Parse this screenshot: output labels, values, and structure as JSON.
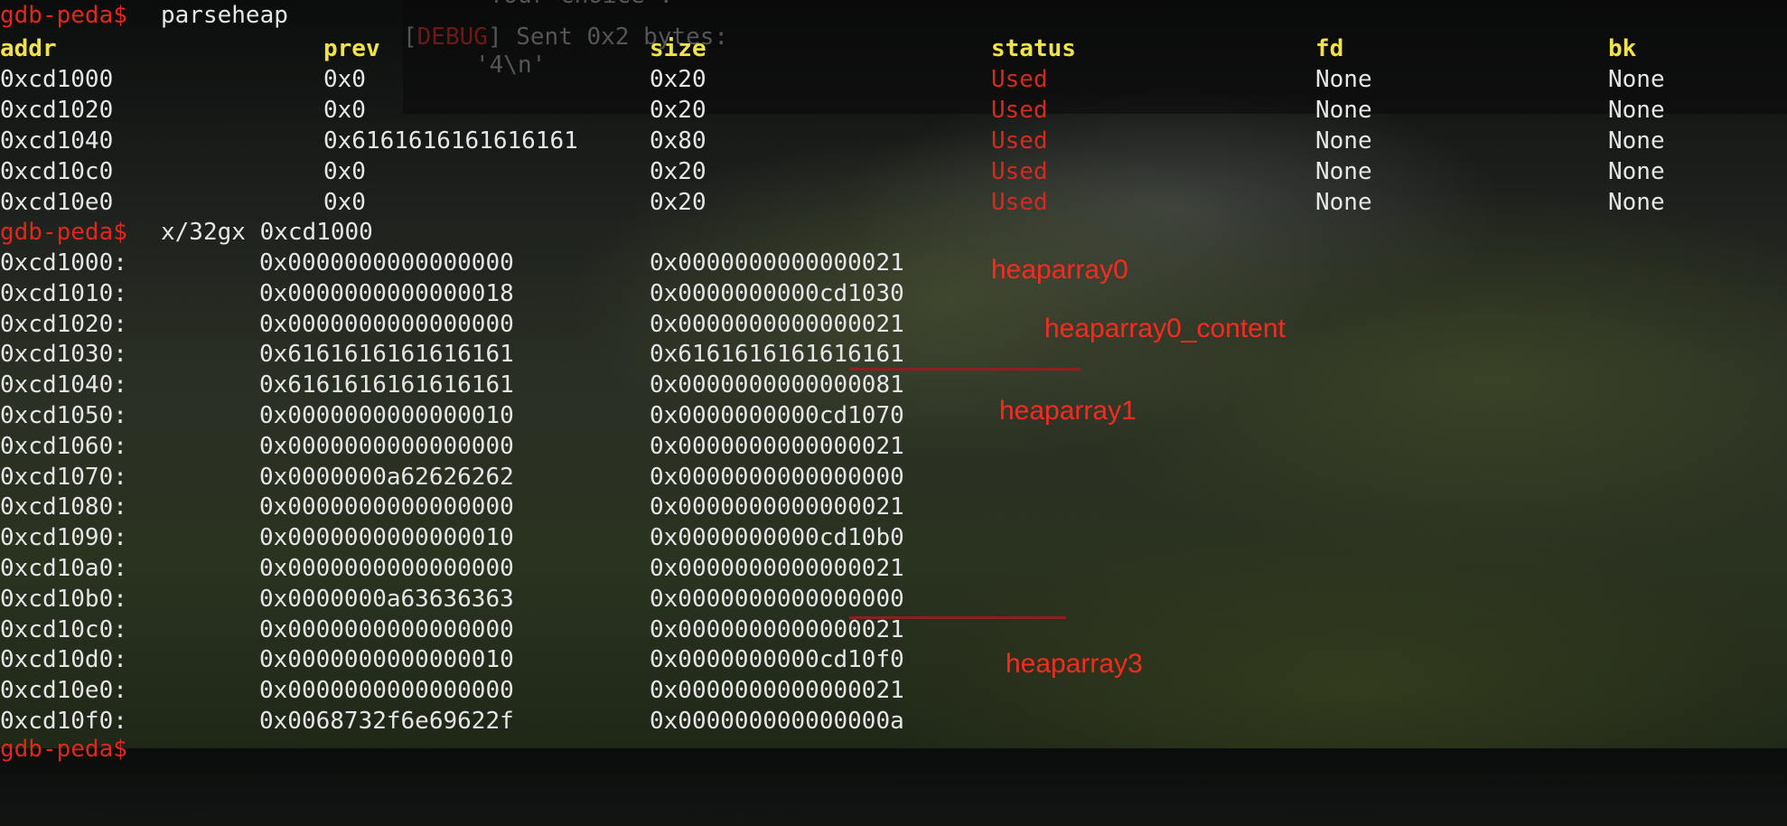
{
  "background_terminal": {
    "lines": [
      "'Your choice :'",
      "Sent 0x2 bytes:",
      "'4\\n'"
    ],
    "debug_tag": "DEBUG"
  },
  "session": {
    "prompt": "gdb-peda$",
    "command1": "parseheap",
    "command2": "x/32gx 0xcd1000",
    "next_prompt": "gdb-peda$"
  },
  "parseheap": {
    "headers": [
      "addr",
      "prev",
      "size",
      "status",
      "fd",
      "bk"
    ],
    "rows": [
      [
        "0xcd1000",
        "0x0",
        "0x20",
        "Used",
        "None",
        "None"
      ],
      [
        "0xcd1020",
        "0x0",
        "0x20",
        "Used",
        "None",
        "None"
      ],
      [
        "0xcd1040",
        "0x6161616161616161",
        "0x80",
        "Used",
        "None",
        "None"
      ],
      [
        "0xcd10c0",
        "0x0",
        "0x20",
        "Used",
        "None",
        "None"
      ],
      [
        "0xcd10e0",
        "0x0",
        "0x20",
        "Used",
        "None",
        "None"
      ]
    ]
  },
  "memory_dump": {
    "rows": [
      [
        "0xcd1000:",
        "0x0000000000000000",
        "0x0000000000000021"
      ],
      [
        "0xcd1010:",
        "0x0000000000000018",
        "0x0000000000cd1030"
      ],
      [
        "0xcd1020:",
        "0x0000000000000000",
        "0x0000000000000021"
      ],
      [
        "0xcd1030:",
        "0x6161616161616161",
        "0x6161616161616161"
      ],
      [
        "0xcd1040:",
        "0x6161616161616161",
        "0x0000000000000081"
      ],
      [
        "0xcd1050:",
        "0x0000000000000010",
        "0x0000000000cd1070"
      ],
      [
        "0xcd1060:",
        "0x0000000000000000",
        "0x0000000000000021"
      ],
      [
        "0xcd1070:",
        "0x0000000a62626262",
        "0x0000000000000000"
      ],
      [
        "0xcd1080:",
        "0x0000000000000000",
        "0x0000000000000021"
      ],
      [
        "0xcd1090:",
        "0x0000000000000010",
        "0x0000000000cd10b0"
      ],
      [
        "0xcd10a0:",
        "0x0000000000000000",
        "0x0000000000000021"
      ],
      [
        "0xcd10b0:",
        "0x0000000a63636363",
        "0x0000000000000000"
      ],
      [
        "0xcd10c0:",
        "0x0000000000000000",
        "0x0000000000000021"
      ],
      [
        "0xcd10d0:",
        "0x0000000000000010",
        "0x0000000000cd10f0"
      ],
      [
        "0xcd10e0:",
        "0x0000000000000000",
        "0x0000000000000021"
      ],
      [
        "0xcd10f0:",
        "0x0068732f6e69622f",
        "0x000000000000000a"
      ]
    ]
  },
  "annotations": [
    "heaparray0",
    "heaparray0_content",
    "heaparray1",
    "heaparray3"
  ],
  "colors": {
    "prompt": "#e3271c",
    "header": "#f2e24a",
    "status_used": "#d32b22",
    "annotation": "#ff2a1f",
    "text": "#e6e6e6"
  }
}
